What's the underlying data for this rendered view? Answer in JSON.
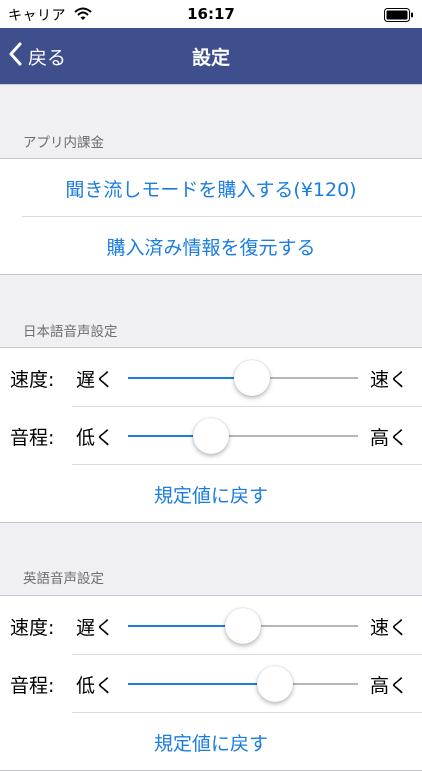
{
  "status_bar": {
    "carrier": "キャリア",
    "time": "16:17"
  },
  "nav": {
    "back_label": "戻る",
    "title": "設定"
  },
  "iap": {
    "header": "アプリ内課金",
    "buy_label": "聞き流しモードを購入する(¥120)",
    "restore_label": "購入済み情報を復元する"
  },
  "japanese_voice": {
    "header": "日本語音声設定",
    "speed": {
      "label": "速度:",
      "min_label": "遅く",
      "max_label": "速く",
      "value": 0.54
    },
    "pitch": {
      "label": "音程:",
      "min_label": "低く",
      "max_label": "高く",
      "value": 0.36
    },
    "reset_label": "規定値に戻す"
  },
  "english_voice": {
    "header": "英語音声設定",
    "speed": {
      "label": "速度:",
      "min_label": "遅く",
      "max_label": "速く",
      "value": 0.5
    },
    "pitch": {
      "label": "音程:",
      "min_label": "低く",
      "max_label": "高く",
      "value": 0.64
    },
    "reset_label": "規定値に戻す"
  },
  "colors": {
    "nav_bar": "#3f4f8e",
    "accent": "#1a7de0",
    "background": "#efeff4"
  },
  "icons": [
    "wifi-icon",
    "battery-icon",
    "chevron-left-icon"
  ]
}
